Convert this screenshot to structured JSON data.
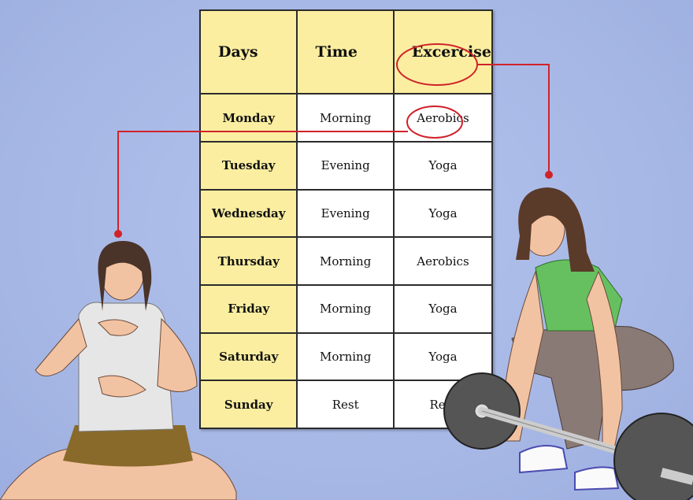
{
  "table": {
    "headers": [
      "Days",
      "Time",
      "Excercise"
    ],
    "rows": [
      {
        "day": "Monday",
        "time": "Morning",
        "exercise": "Aerobics",
        "circled": true
      },
      {
        "day": "Tuesday",
        "time": "Evening",
        "exercise": "Yoga",
        "circled": true
      },
      {
        "day": "Wednesday",
        "time": "Evening",
        "exercise": "Yoga"
      },
      {
        "day": "Thursday",
        "time": "Morning",
        "exercise": "Aerobics"
      },
      {
        "day": "Friday",
        "time": "Morning",
        "exercise": "Yoga"
      },
      {
        "day": "Saturday",
        "time": "Morning",
        "exercise": "Yoga"
      },
      {
        "day": "Sunday",
        "time": "Rest",
        "exercise": "Rest"
      }
    ]
  },
  "colors": {
    "background": "#a9b9e6",
    "header_fill": "#fbeea0",
    "annotation": "#d0222a"
  }
}
